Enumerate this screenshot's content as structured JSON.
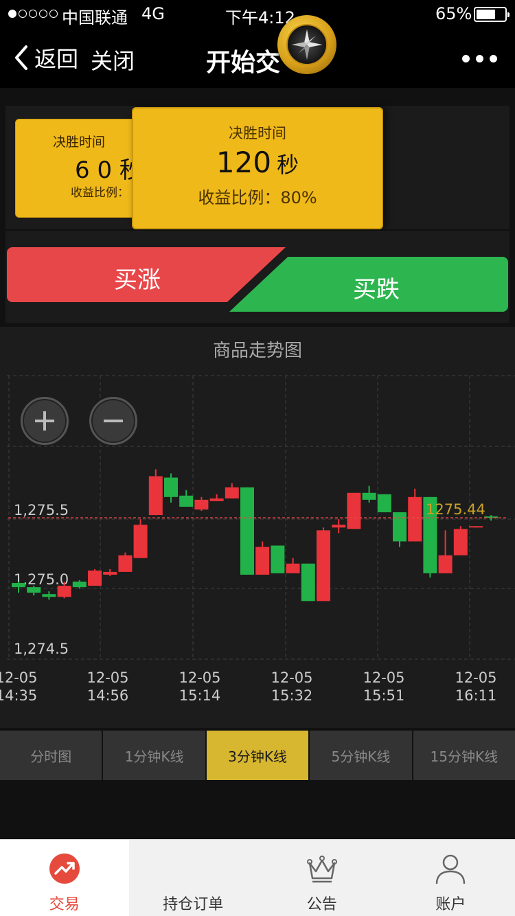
{
  "status": {
    "carrier": "中国联通",
    "network": "4G",
    "time": "下午4:12",
    "battery": "65%"
  },
  "nav": {
    "back": "返回",
    "close": "关闭",
    "title": "开始交"
  },
  "cards": {
    "back": {
      "label": "决胜时间",
      "seconds": "6 0 秒",
      "rate": "收益比例："
    },
    "front": {
      "label": "决胜时间",
      "seconds": "120",
      "unit": "秒",
      "rate": "收益比例：80%"
    }
  },
  "buttons": {
    "up": "买涨",
    "down": "买跌"
  },
  "chart_title": "商品走势图",
  "chart_data": {
    "type": "candlestick",
    "title": "商品走势图",
    "y_tick_labels": [
      "1,275.5",
      "1,275.0",
      "1,274.5"
    ],
    "y_ticks": [
      1275.5,
      1275.0,
      1274.5
    ],
    "x_tick_labels": [
      [
        "12-05",
        "14:35"
      ],
      [
        "12-05",
        "14:56"
      ],
      [
        "12-05",
        "15:14"
      ],
      [
        "12-05",
        "15:32"
      ],
      [
        "12-05",
        "15:51"
      ],
      [
        "12-05",
        "16:11"
      ]
    ],
    "current_price": "1275.44",
    "up_color": "#e8343a",
    "down_color": "#22b24a",
    "candles": [
      {
        "o": 1274.97,
        "c": 1274.94,
        "h": 1274.98,
        "l": 1274.9
      },
      {
        "o": 1274.94,
        "c": 1274.9,
        "h": 1274.95,
        "l": 1274.88
      },
      {
        "o": 1274.89,
        "c": 1274.87,
        "h": 1274.91,
        "l": 1274.85
      },
      {
        "o": 1274.87,
        "c": 1274.95,
        "h": 1274.98,
        "l": 1274.86
      },
      {
        "o": 1274.98,
        "c": 1274.94,
        "h": 1274.99,
        "l": 1274.93
      },
      {
        "o": 1274.95,
        "c": 1275.06,
        "h": 1275.07,
        "l": 1274.95
      },
      {
        "o": 1275.03,
        "c": 1275.05,
        "h": 1275.07,
        "l": 1275.02
      },
      {
        "o": 1275.05,
        "c": 1275.17,
        "h": 1275.19,
        "l": 1275.05
      },
      {
        "o": 1275.15,
        "c": 1275.39,
        "h": 1275.43,
        "l": 1275.15
      },
      {
        "o": 1275.46,
        "c": 1275.74,
        "h": 1275.79,
        "l": 1275.46
      },
      {
        "o": 1275.73,
        "c": 1275.59,
        "h": 1275.76,
        "l": 1275.55
      },
      {
        "o": 1275.6,
        "c": 1275.52,
        "h": 1275.64,
        "l": 1275.52
      },
      {
        "o": 1275.5,
        "c": 1275.57,
        "h": 1275.59,
        "l": 1275.49
      },
      {
        "o": 1275.56,
        "c": 1275.58,
        "h": 1275.61,
        "l": 1275.56
      },
      {
        "o": 1275.58,
        "c": 1275.66,
        "h": 1275.69,
        "l": 1275.58
      },
      {
        "o": 1275.66,
        "c": 1275.03,
        "h": 1275.66,
        "l": 1275.03
      },
      {
        "o": 1275.03,
        "c": 1275.23,
        "h": 1275.27,
        "l": 1275.03
      },
      {
        "o": 1275.24,
        "c": 1275.04,
        "h": 1275.24,
        "l": 1275.04
      },
      {
        "o": 1275.04,
        "c": 1275.11,
        "h": 1275.15,
        "l": 1275.04
      },
      {
        "o": 1275.11,
        "c": 1274.84,
        "h": 1275.11,
        "l": 1274.84
      },
      {
        "o": 1274.84,
        "c": 1275.35,
        "h": 1275.37,
        "l": 1274.84
      },
      {
        "o": 1275.37,
        "c": 1275.39,
        "h": 1275.43,
        "l": 1275.33
      },
      {
        "o": 1275.36,
        "c": 1275.62,
        "h": 1275.62,
        "l": 1275.36
      },
      {
        "o": 1275.62,
        "c": 1275.57,
        "h": 1275.67,
        "l": 1275.55
      },
      {
        "o": 1275.61,
        "c": 1275.48,
        "h": 1275.61,
        "l": 1275.48
      },
      {
        "o": 1275.48,
        "c": 1275.27,
        "h": 1275.48,
        "l": 1275.23
      },
      {
        "o": 1275.27,
        "c": 1275.59,
        "h": 1275.65,
        "l": 1275.27
      },
      {
        "o": 1275.59,
        "c": 1275.04,
        "h": 1275.59,
        "l": 1275.01
      },
      {
        "o": 1275.04,
        "c": 1275.17,
        "h": 1275.35,
        "l": 1275.04
      },
      {
        "o": 1275.17,
        "c": 1275.36,
        "h": 1275.38,
        "l": 1275.17
      },
      {
        "o": 1275.37,
        "c": 1275.38,
        "h": 1275.38,
        "l": 1275.37
      },
      {
        "o": 1275.45,
        "c": 1275.44,
        "h": 1275.46,
        "l": 1275.42
      }
    ]
  },
  "tabs": [
    "分时图",
    "1分钟K线",
    "3分钟K线",
    "5分钟K线",
    "15分钟K线"
  ],
  "active_tab": "3分钟K线",
  "tabbar": [
    {
      "label": "交易",
      "icon": "trend-up-icon"
    },
    {
      "label": "持仓订单",
      "icon": ""
    },
    {
      "label": "公告",
      "icon": "crown-icon"
    },
    {
      "label": "账户",
      "icon": "user-icon"
    }
  ],
  "colors": {
    "gold": "#f0b91a",
    "up": "#e8474a",
    "down": "#2db54f",
    "active_tab": "#d7b630"
  }
}
